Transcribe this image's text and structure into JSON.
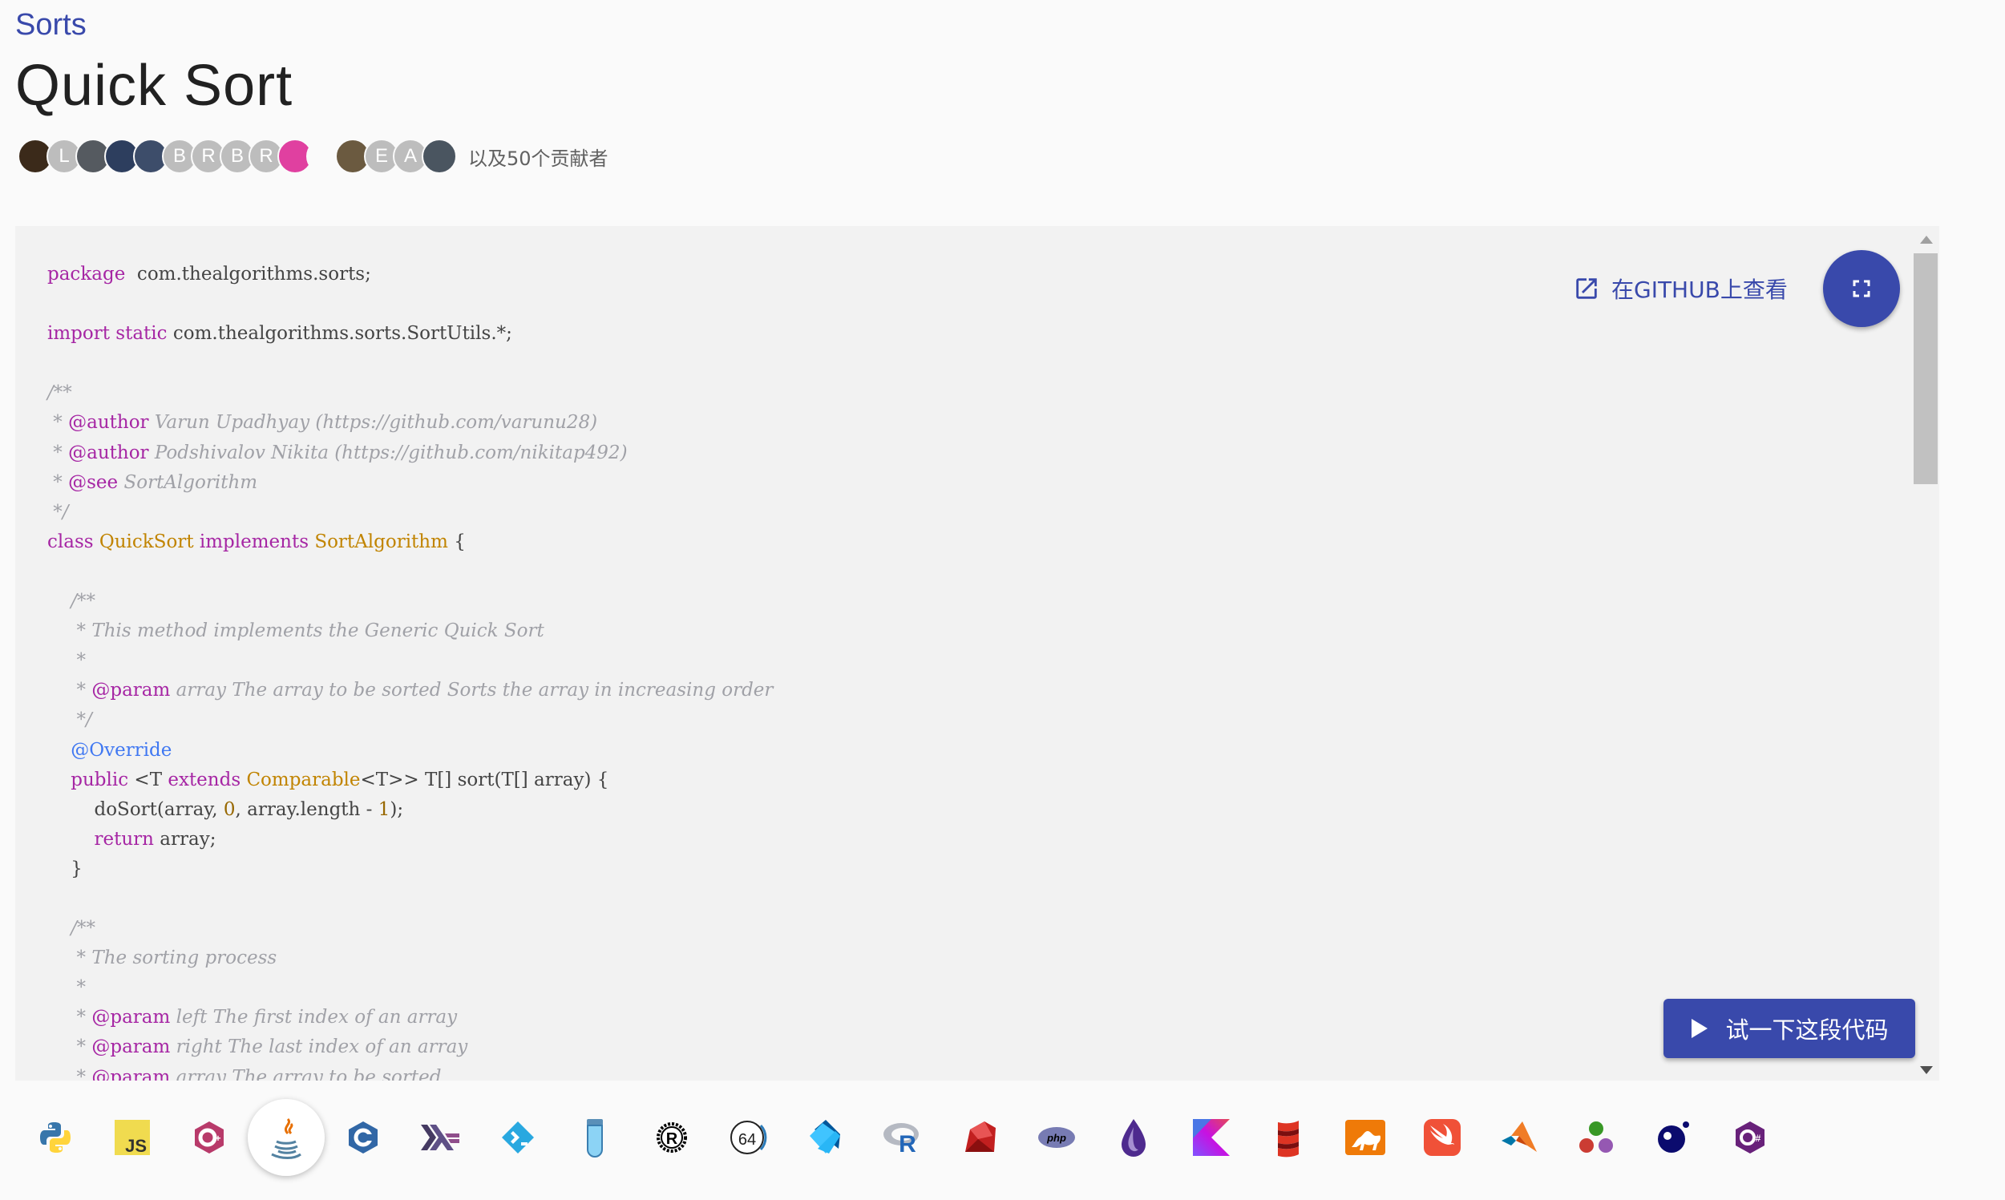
{
  "breadcrumb": "Sorts",
  "page_title": "Quick Sort",
  "contributors": {
    "avatars": [
      {
        "type": "photo",
        "color": "#3b2a1a"
      },
      {
        "type": "letter",
        "letter": "L"
      },
      {
        "type": "photo",
        "color": "#555a60"
      },
      {
        "type": "photo",
        "color": "#2d3e5e"
      },
      {
        "type": "photo",
        "color": "#3d4d6a"
      },
      {
        "type": "letter",
        "letter": "B"
      },
      {
        "type": "letter",
        "letter": "R"
      },
      {
        "type": "letter",
        "letter": "B"
      },
      {
        "type": "letter",
        "letter": "R"
      },
      {
        "type": "photo",
        "color": "#e040a0"
      },
      {
        "type": "photo",
        "color": "#fafafa"
      },
      {
        "type": "photo",
        "color": "#6b5a40"
      },
      {
        "type": "letter",
        "letter": "E"
      },
      {
        "type": "letter",
        "letter": "A"
      },
      {
        "type": "photo",
        "color": "#4a5560"
      }
    ],
    "more_text": "以及50个贡献者"
  },
  "code": {
    "lines": [
      [
        [
          "kw",
          "package"
        ],
        [
          "",
          "  com.thealgorithms.sorts;"
        ]
      ],
      [],
      [
        [
          "kw",
          "import"
        ],
        [
          "",
          " "
        ],
        [
          "kw",
          "static"
        ],
        [
          "",
          "",
          " com.thealgorithms.sorts.SortUtils.*;"
        ]
      ],
      [],
      [
        [
          "cm",
          "/**"
        ]
      ],
      [
        [
          "cm",
          " * "
        ],
        [
          "dt",
          "@author"
        ],
        [
          "cm",
          " Varun Upadhyay (https://github.com/varunu28)"
        ]
      ],
      [
        [
          "cm",
          " * "
        ],
        [
          "dt",
          "@author"
        ],
        [
          "cm",
          " Podshivalov Nikita (https://github.com/nikitap492)"
        ]
      ],
      [
        [
          "cm",
          " * "
        ],
        [
          "dt",
          "@see"
        ],
        [
          "cm",
          " SortAlgorithm"
        ]
      ],
      [
        [
          "cm",
          " */"
        ]
      ],
      [
        [
          "kw",
          "class"
        ],
        [
          "",
          " "
        ],
        [
          "ty",
          "QuickSort"
        ],
        [
          "",
          " "
        ],
        [
          "kw",
          "implements"
        ],
        [
          "",
          " "
        ],
        [
          "ty",
          "SortAlgorithm"
        ],
        [
          "",
          " {"
        ]
      ],
      [],
      [
        [
          "cm",
          "    /**"
        ]
      ],
      [
        [
          "cm",
          "     * This method implements the Generic Quick Sort"
        ]
      ],
      [
        [
          "cm",
          "     *"
        ]
      ],
      [
        [
          "cm",
          "     * "
        ],
        [
          "dt",
          "@param"
        ],
        [
          "cm",
          " array The array to be sorted Sorts the array in increasing order"
        ]
      ],
      [
        [
          "cm",
          "     */"
        ]
      ],
      [
        [
          "an",
          "    @Override"
        ]
      ],
      [
        [
          "",
          ""
        ],
        [
          "kw",
          "    public"
        ],
        [
          "",
          " <T "
        ],
        [
          "kw",
          "extends"
        ],
        [
          "",
          " "
        ],
        [
          "ty",
          "Comparable"
        ],
        [
          "",
          "<T>> T[] sort(T[] array) {"
        ]
      ],
      [
        [
          "",
          "        doSort(array, "
        ],
        [
          "nu",
          "0"
        ],
        [
          "",
          ", array.length - "
        ],
        [
          "nu",
          "1"
        ],
        [
          "",
          ");"
        ]
      ],
      [
        [
          "kw",
          "        return"
        ],
        [
          "",
          " array;"
        ]
      ],
      [
        [
          "",
          "    }"
        ]
      ],
      [],
      [
        [
          "cm",
          "    /**"
        ]
      ],
      [
        [
          "cm",
          "     * The sorting process"
        ]
      ],
      [
        [
          "cm",
          "     *"
        ]
      ],
      [
        [
          "cm",
          "     * "
        ],
        [
          "dt",
          "@param"
        ],
        [
          "cm",
          " left The first index of an array"
        ]
      ],
      [
        [
          "cm",
          "     * "
        ],
        [
          "dt",
          "@param"
        ],
        [
          "cm",
          " right The last index of an array"
        ]
      ],
      [
        [
          "cm",
          "     * "
        ],
        [
          "dt",
          "@param"
        ],
        [
          "cm",
          " array The array to be sorted"
        ]
      ]
    ]
  },
  "github_link": "在GITHUB上查看",
  "run_button": "试一下这段代码",
  "languages": {
    "active": "java",
    "items": [
      "python",
      "javascript",
      "c-plus-plus",
      "java",
      "c",
      "haskell",
      "go",
      "elixir-vial",
      "rust",
      "assembly-64",
      "dart",
      "r",
      "ruby",
      "php",
      "elixir",
      "kotlin",
      "scala",
      "ocaml",
      "swift",
      "matlab",
      "julia",
      "zig",
      "c-sharp"
    ]
  }
}
